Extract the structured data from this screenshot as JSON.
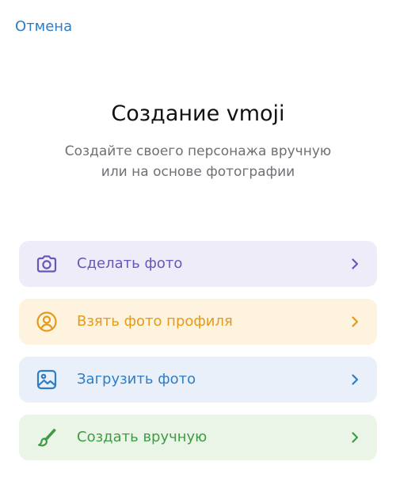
{
  "header": {
    "cancel_label": "Отмена"
  },
  "intro": {
    "title": "Создание vmoji",
    "subtitle_line1": "Создайте своего персонажа вручную",
    "subtitle_line2": "или на основе фотографии"
  },
  "options": [
    {
      "label": "Сделать фото",
      "icon": "camera-icon",
      "color": "#6a55b8",
      "background": "#efecfa"
    },
    {
      "label": "Взять фото профиля",
      "icon": "user-circle-icon",
      "color": "#e39b1c",
      "background": "#fdf3df"
    },
    {
      "label": "Загрузить фото",
      "icon": "image-icon",
      "color": "#2f7dc4",
      "background": "#e9f0fa"
    },
    {
      "label": "Создать вручную",
      "icon": "brush-icon",
      "color": "#3f9c44",
      "background": "#eaf5e7"
    }
  ],
  "colors": {
    "accent": "#2f7dc4",
    "title": "#111111",
    "subtitle": "#6d7075"
  }
}
